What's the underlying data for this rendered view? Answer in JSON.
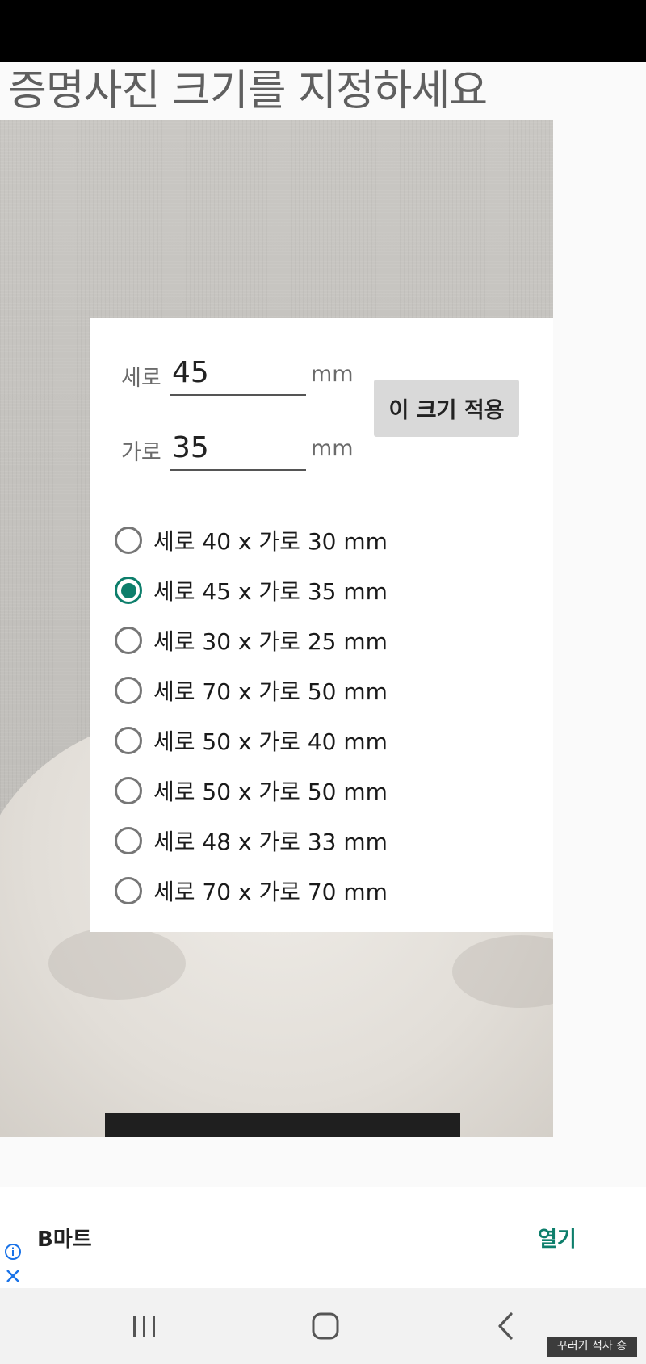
{
  "page": {
    "title": "증명사진 크기를 지정하세요"
  },
  "size_form": {
    "height_label": "세로",
    "height_value": "45",
    "height_unit": "mm",
    "width_label": "가로",
    "width_value": "35",
    "width_unit": "mm",
    "apply_button": "이 크기 적용"
  },
  "size_options": [
    {
      "label": "세로 40 x 가로 30 mm",
      "selected": false
    },
    {
      "label": "세로 45 x 가로 35 mm",
      "selected": true
    },
    {
      "label": "세로 30 x 가로 25 mm",
      "selected": false
    },
    {
      "label": "세로 70 x 가로 50 mm",
      "selected": false
    },
    {
      "label": "세로 50 x 가로 40 mm",
      "selected": false
    },
    {
      "label": "세로 50 x 가로 50 mm",
      "selected": false
    },
    {
      "label": "세로 48 x 가로 33 mm",
      "selected": false
    },
    {
      "label": "세로 70 x 가로 70 mm",
      "selected": false
    }
  ],
  "ad": {
    "name": "B마트",
    "open_label": "열기",
    "info_icon": "info-icon",
    "close_icon": "close-icon"
  },
  "nav": {
    "recents_icon": "recents-icon",
    "home_icon": "home-icon",
    "back_icon": "back-icon"
  },
  "watermark": "꾸러기 석사 숑",
  "colors": {
    "accent": "#0d7e6b",
    "status_bar": "#000000",
    "button_bg": "#d9d9d9"
  }
}
